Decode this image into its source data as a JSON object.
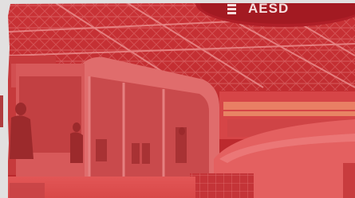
{
  "image": {
    "subject": "exhibition-stand-under-roof-truss",
    "tint_color": "#d93a3a",
    "frame_color": "#e2e0e0"
  },
  "banner": {
    "text": "AESD"
  },
  "colors": {
    "ceiling": "#b82a2c",
    "truss": "#e07070",
    "booth_wall": "#e87a78",
    "glass": "#c94a4c",
    "floor": "#e05252",
    "banner_ring": "#c02830"
  }
}
